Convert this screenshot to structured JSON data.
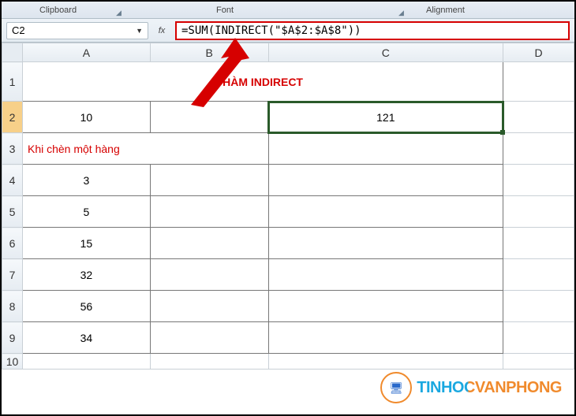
{
  "ribbon": {
    "format_painter_hint": "",
    "group_clipboard": "Clipboard",
    "group_font": "Font",
    "group_alignment": "Alignment"
  },
  "namebox": {
    "value": "C2"
  },
  "formula_bar": {
    "fx_label": "fx",
    "value": "=SUM(INDIRECT(\"$A$2:$A$8\"))"
  },
  "columns": {
    "a": "A",
    "b": "B",
    "c": "C",
    "d": "D"
  },
  "rows": {
    "r1": "1",
    "r2": "2",
    "r3": "3",
    "r4": "4",
    "r5": "5",
    "r6": "6",
    "r7": "7",
    "r8": "8",
    "r9": "9",
    "r10": "10"
  },
  "cells": {
    "title": "HÀM INDIRECT",
    "a2": "10",
    "c2": "121",
    "a3_note": "Khi chèn một hàng",
    "a4": "3",
    "a5": "5",
    "a6": "15",
    "a7": "32",
    "a8": "56",
    "a9": "34"
  },
  "watermark": {
    "text": "TINHOCVANPHONG"
  }
}
